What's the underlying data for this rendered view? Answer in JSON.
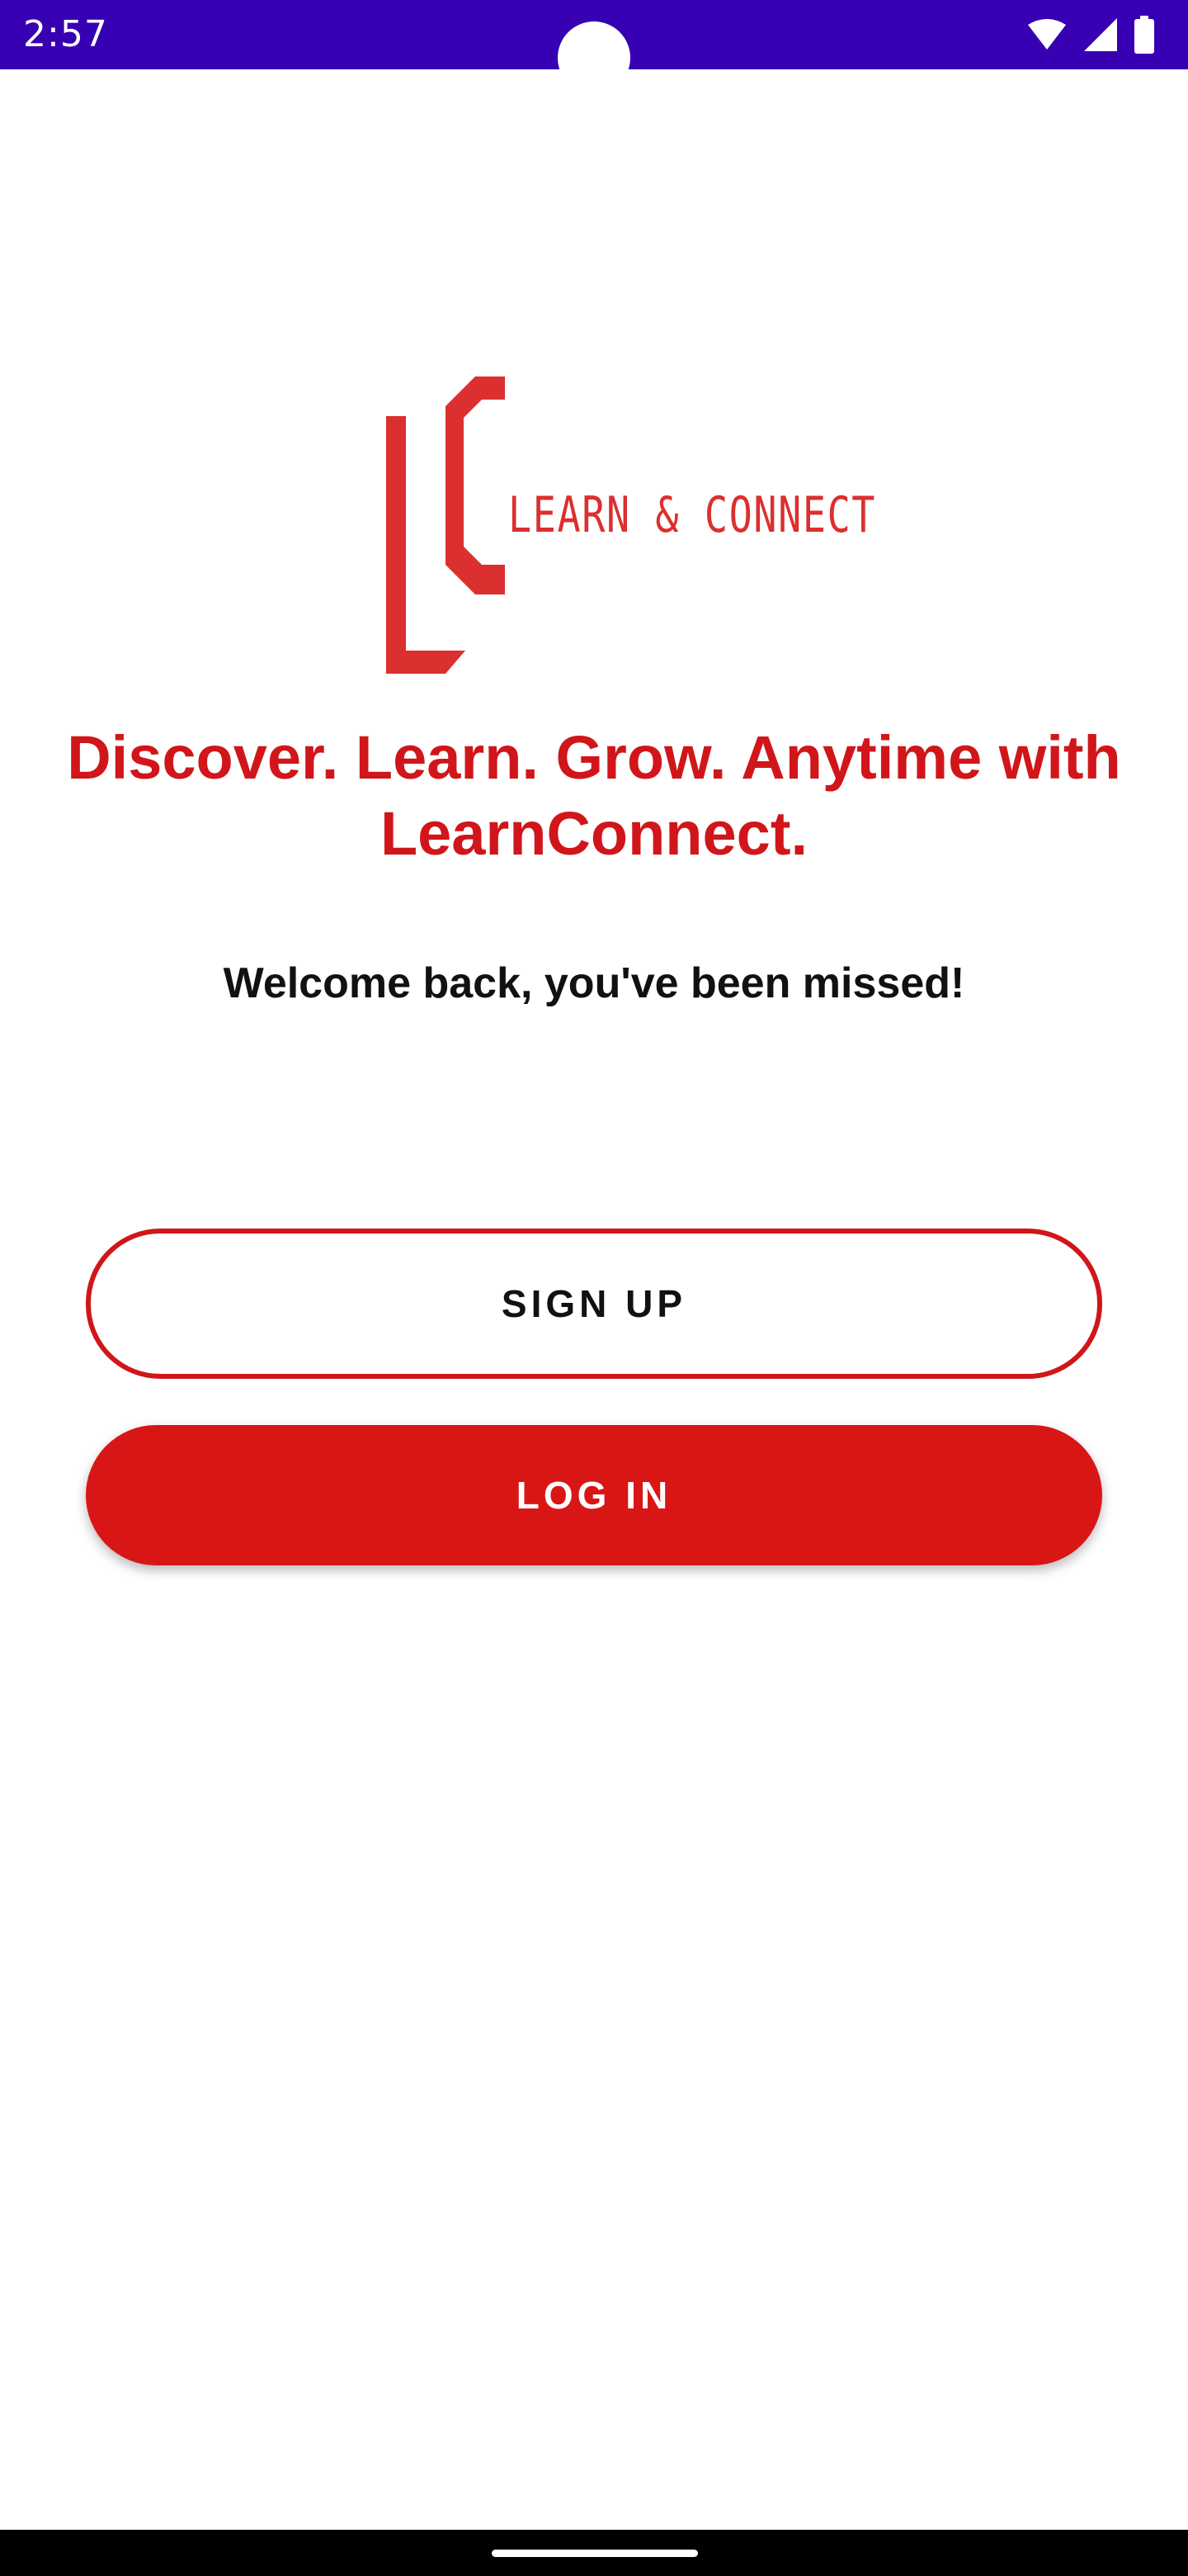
{
  "status_bar": {
    "time": "2:57",
    "background": "#3700b3",
    "icons": [
      "wifi-icon",
      "signal-icon",
      "battery-icon"
    ]
  },
  "logo": {
    "monogram": "LC",
    "wordmark": "LEARN & CONNECT",
    "color": "#dc2f2f"
  },
  "header": {
    "tagline": "Discover. Learn. Grow. Anytime with LearnConnect.",
    "welcome": "Welcome back, you've been missed!"
  },
  "actions": {
    "signup_label": "SIGN UP",
    "login_label": "LOG IN"
  },
  "colors": {
    "accent": "#d0161a",
    "login_fill": "#d91616",
    "text": "#111111"
  }
}
